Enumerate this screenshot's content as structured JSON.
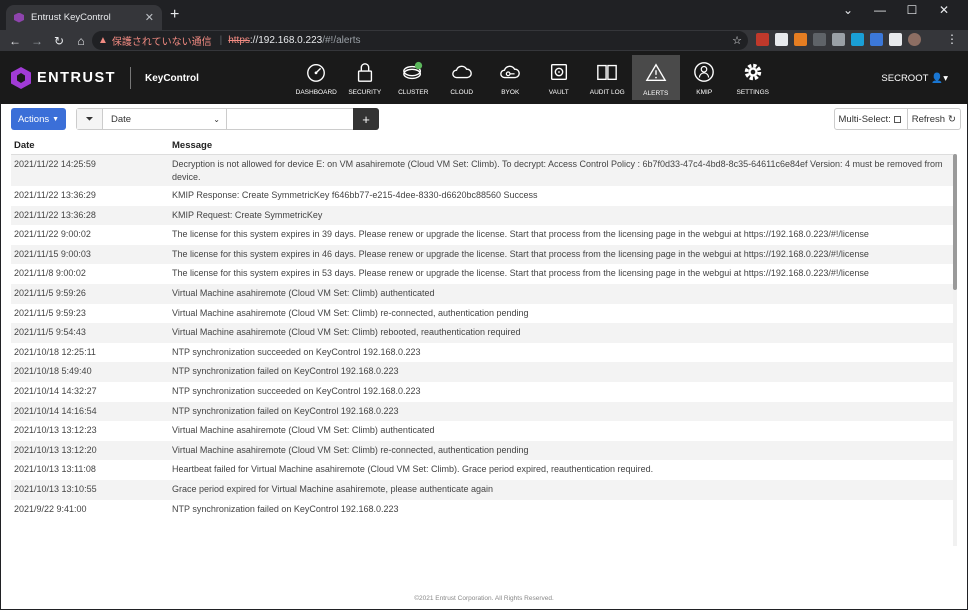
{
  "browser": {
    "tab_title": "Entrust KeyControl",
    "tab_close": "✕",
    "new_tab": "+",
    "window_controls": [
      "⌄",
      "—",
      "☐",
      "✕"
    ],
    "warning_text": "保護されていない通信",
    "url_scheme": "https",
    "url_host": "://192.168.0.223",
    "url_path": "/#!/alerts",
    "menu": "⋮"
  },
  "header": {
    "brand": "ENTRUST",
    "product": "KeyControl",
    "nav": [
      {
        "label": "DASHBOARD",
        "icon": "dashboard-icon"
      },
      {
        "label": "SECURITY",
        "icon": "lock-icon"
      },
      {
        "label": "CLUSTER",
        "icon": "cluster-icon"
      },
      {
        "label": "CLOUD",
        "icon": "cloud-icon"
      },
      {
        "label": "BYOK",
        "icon": "key-cloud-icon"
      },
      {
        "label": "VAULT",
        "icon": "vault-icon"
      },
      {
        "label": "AUDIT LOG",
        "icon": "book-icon"
      },
      {
        "label": "ALERTS",
        "icon": "warning-icon"
      },
      {
        "label": "KMIP",
        "icon": "kmip-icon"
      },
      {
        "label": "SETTINGS",
        "icon": "gear-icon"
      }
    ],
    "user": "SECROOT"
  },
  "toolbar": {
    "actions_label": "Actions",
    "filter_field": "Date",
    "filter_value": "",
    "multi_select_label": "Multi-Select:",
    "refresh_label": "Refresh"
  },
  "table": {
    "columns": [
      "Date",
      "Message"
    ],
    "rows": [
      {
        "date": "2021/11/22 14:25:59",
        "message": "Decryption is not allowed for device E: on VM asahiremote (Cloud VM Set: Climb). To decrypt: Access Control Policy : 6b7f0d33-47c4-4bd8-8c35-64611c6e84ef Version: 4 must be removed from device."
      },
      {
        "date": "2021/11/22 13:36:29",
        "message": "KMIP Response: Create SymmetricKey f646bb77-e215-4dee-8330-d6620bc88560 Success"
      },
      {
        "date": "2021/11/22 13:36:28",
        "message": "KMIP Request: Create SymmetricKey"
      },
      {
        "date": "2021/11/22 9:00:02",
        "message": "The license for this system expires in 39 days. Please renew or upgrade the license. Start that process from the licensing page in the webgui at https://192.168.0.223/#!/license"
      },
      {
        "date": "2021/11/15 9:00:03",
        "message": "The license for this system expires in 46 days. Please renew or upgrade the license. Start that process from the licensing page in the webgui at https://192.168.0.223/#!/license"
      },
      {
        "date": "2021/11/8 9:00:02",
        "message": "The license for this system expires in 53 days. Please renew or upgrade the license. Start that process from the licensing page in the webgui at https://192.168.0.223/#!/license"
      },
      {
        "date": "2021/11/5 9:59:26",
        "message": "Virtual Machine asahiremote (Cloud VM Set: Climb) authenticated"
      },
      {
        "date": "2021/11/5 9:59:23",
        "message": "Virtual Machine asahiremote (Cloud VM Set: Climb) re-connected, authentication pending"
      },
      {
        "date": "2021/11/5 9:54:43",
        "message": "Virtual Machine asahiremote (Cloud VM Set: Climb) rebooted, reauthentication required"
      },
      {
        "date": "2021/10/18 12:25:11",
        "message": "NTP synchronization succeeded on KeyControl 192.168.0.223"
      },
      {
        "date": "2021/10/18 5:49:40",
        "message": "NTP synchronization failed on KeyControl 192.168.0.223"
      },
      {
        "date": "2021/10/14 14:32:27",
        "message": "NTP synchronization succeeded on KeyControl 192.168.0.223"
      },
      {
        "date": "2021/10/14 14:16:54",
        "message": "NTP synchronization failed on KeyControl 192.168.0.223"
      },
      {
        "date": "2021/10/13 13:12:23",
        "message": "Virtual Machine asahiremote (Cloud VM Set: Climb) authenticated"
      },
      {
        "date": "2021/10/13 13:12:20",
        "message": "Virtual Machine asahiremote (Cloud VM Set: Climb) re-connected, authentication pending"
      },
      {
        "date": "2021/10/13 13:11:08",
        "message": "Heartbeat failed for Virtual Machine asahiremote (Cloud VM Set: Climb). Grace period expired, reauthentication required."
      },
      {
        "date": "2021/10/13 13:10:55",
        "message": "Grace period expired for Virtual Machine asahiremote, please authenticate again"
      },
      {
        "date": "2021/9/22 9:41:00",
        "message": "NTP synchronization failed on KeyControl 192.168.0.223"
      }
    ]
  },
  "footer": "©2021 Entrust Corporation. All Rights Reserved.",
  "colors": {
    "accent": "#3b6fd8",
    "header_bg": "#1a1a1a",
    "brand": "#a13bd6",
    "cluster_badge": "#5cb85c"
  }
}
